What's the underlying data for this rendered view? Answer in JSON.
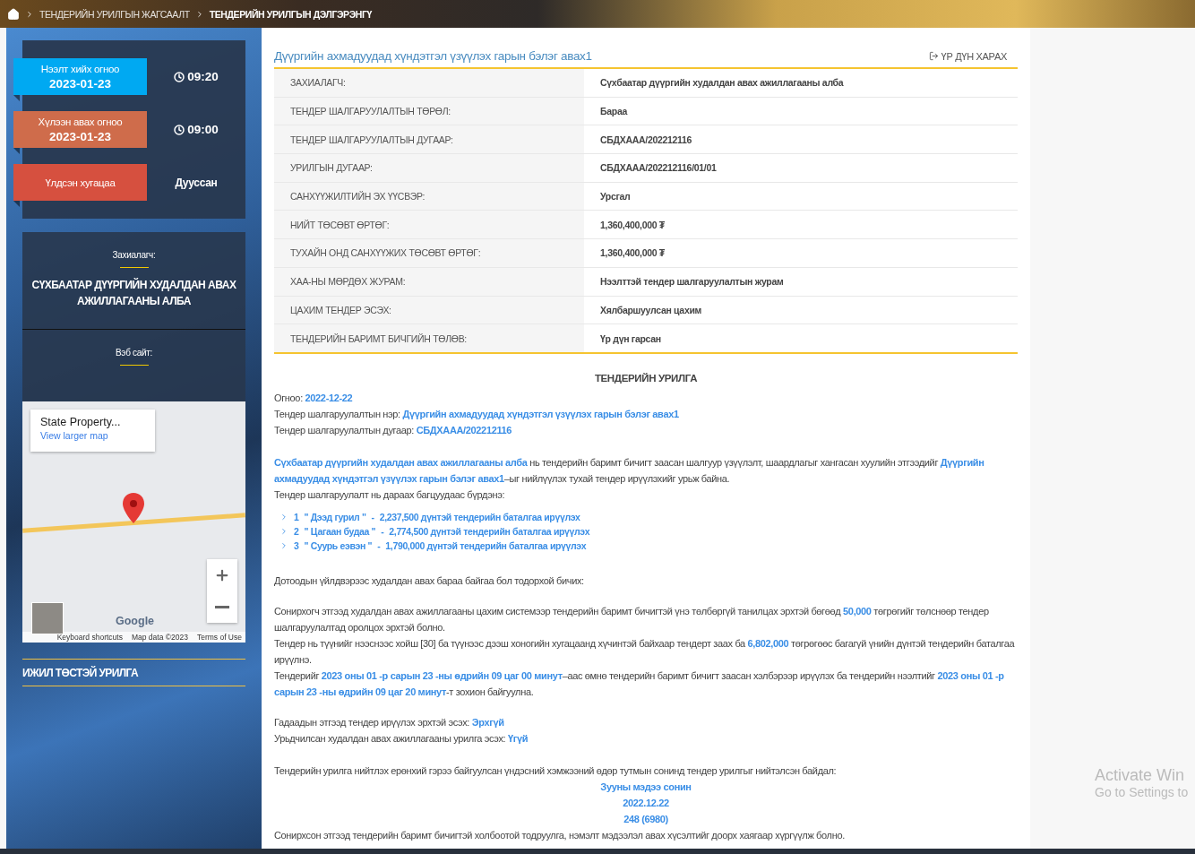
{
  "breadcrumb": {
    "items": [
      "ТЕНДЕРИЙН УРИЛГЫН ЖАГСААЛТ",
      "ТЕНДЕРИЙН УРИЛГЫН ДЭЛГЭРЭНГҮ"
    ]
  },
  "schedule": [
    {
      "kind": "time",
      "label": "Нээлт хийх огноо",
      "date": "2023-01-23",
      "value": "09:20",
      "color": "#00a9f2"
    },
    {
      "kind": "time",
      "label": "Хүлээн авах огноо",
      "date": "2023-01-23",
      "value": "09:00",
      "color": "#cf6c4b"
    },
    {
      "kind": "status",
      "label": "Үлдсэн хугацаа",
      "value": "Дууссан",
      "color": "#d6503f"
    }
  ],
  "customer": {
    "label": "Захиалагч:",
    "name": "СҮХБААТАР ДҮҮРГИЙН ХУДАЛДАН АВАХ АЖИЛЛАГААНЫ АЛБА",
    "website_label": "Вэб сайт:"
  },
  "map": {
    "place": "State Property...",
    "link": "View larger map",
    "logo": "Google",
    "footer": [
      "Keyboard shortcuts",
      "Map data ©2023",
      "Terms of Use"
    ]
  },
  "related": {
    "heading": "ИЖИЛ ТӨСТЭЙ УРИЛГА"
  },
  "tender": {
    "title": "Дүүргийн ахмадуудад хүндэтгэл үзүүлэх гарын бэлэг авах1",
    "result_link": "ҮР ДҮН ХАРАХ"
  },
  "details": [
    {
      "label": "ЗАХИАЛАГЧ:",
      "value": "Сүхбаатар дүүргийн худалдан авах ажиллагааны алба"
    },
    {
      "label": "ТЕНДЕР ШАЛГАРУУЛАЛТЫН ТӨРӨЛ:",
      "value": "Бараа"
    },
    {
      "label": "ТЕНДЕР ШАЛГАРУУЛАЛТЫН ДУГААР:",
      "value": "СБДХААА/202212116"
    },
    {
      "label": "УРИЛГЫН ДУГААР:",
      "value": "СБДХААА/202212116/01/01"
    },
    {
      "label": "САНХҮҮЖИЛТИЙН ЭХ ҮҮСВЭР:",
      "value": "Урсгал"
    },
    {
      "label": "НИЙТ ТӨСӨВТ ӨРТӨГ:",
      "value": "1,360,400,000 ₮"
    },
    {
      "label": "ТУХАЙН ОНД САНХҮҮЖИХ ТӨСӨВТ ӨРТӨГ:",
      "value": "1,360,400,000 ₮"
    },
    {
      "label": "ХАА-НЫ МӨРДӨХ ЖУРАМ:",
      "value": "Нээлттэй тендер шалгаруулалтын журам"
    },
    {
      "label": "ЦАХИМ ТЕНДЕР ЭСЭХ:",
      "value": "Хялбаршуулсан цахим"
    },
    {
      "label": "ТЕНДЕРИЙН БАРИМТ БИЧГИЙН ТӨЛӨВ:",
      "value": "Үр дүн гарсан"
    }
  ],
  "notice": {
    "heading": "ТЕНДЕРИЙН УРИЛГА",
    "meta": [
      {
        "label": "Огноо:",
        "value": "2022-12-22"
      },
      {
        "label": "Тендер шалгаруулалтын нэр:",
        "value": "Дүүргийн ахмадуудад хүндэтгэл үзүүлэх гарын бэлэг авах1"
      },
      {
        "label": "Тендер шалгаруулалтын дугаар:",
        "value": "СБДХААА/202212116"
      }
    ],
    "intro": [
      "**Сүхбаатар дүүргийн худалдан авах ажиллагааны алба** нь тендерийн баримт бичигт заасан шалгуур үзүүлэлт, шаардлагыг хангасан хуулийн этгээдийг **Дүүргийн ахмадуудад хүндэтгэл үзүүлэх гарын бэлэг авах1**–ыг нийлүүлэх тухай тендер ирүүлэхийг урьж байна.",
      "Тендер шалгаруулалт нь дараах багцуудаас бүрдэнэ:"
    ],
    "lots": [
      {
        "number": "1",
        "name": "\" Дээд гурил \"",
        "separator": "-",
        "guarantee": "2,237,500 дүнтэй тендерийн баталгаа ирүүлэх"
      },
      {
        "number": "2",
        "name": "\" Цагаан будаа \"",
        "separator": "-",
        "guarantee": "2,774,500 дүнтэй тендерийн баталгаа ирүүлэх"
      },
      {
        "number": "3",
        "name": "\" Суурь еэвэн \"",
        "separator": "-",
        "guarantee": "1,790,000 дүнтэй тендерийн баталгаа ирүүлэх"
      }
    ],
    "groups": [
      [
        "Дотоодын үйлдвэрээс худалдан авах бараа байгаа бол тодорхой бичих:"
      ],
      [
        "Сонирхогч этгээд худалдан авах ажиллагааны цахим системээр тендерийн баримт бичигтэй үнэ төлбөргүй танилцах эрхтэй бөгөөд **50,000** төгрөгийг төлснөөр тендер шалгаруулалтад оролцох эрхтэй болно.",
        "Тендер нь түүнийг нээснээс хойш [30] ба түүнээс дээш хоногийн хугацаанд хүчинтэй байхаар тендерт заах ба **6,802,000** төгрөгөөс багагүй үнийн дүнтэй тендерийн баталгаа ирүүлнэ.",
        "Тендерийг **2023 оны 01 -р сарын 23 -ны өдрийн 09 цаг 00 минут**–аас өмнө тендерийн баримт бичигт заасан хэлбэрээр ирүүлэх ба тендерийн нээлтийг **2023 оны 01 -р сарын 23 -ны өдрийн 09 цаг 20 минут**-т зохион байгуулна."
      ],
      [
        "Гадаадын этгээд тендер ирүүлэх эрхтэй эсэх:  **Эрхгүй**",
        "Урьдчилсан худалдан авах ажиллагааны урилга эсэх:  **Үгүй**"
      ]
    ],
    "publication": {
      "intro": "Тендерийн урилга нийтлэх ерөнхий гэрээ байгуулсан үндэсний хэмжээний өдөр тутмын сонинд тендер урилгыг нийтэлсэн байдал:",
      "lines": [
        "Зууны мэдээ сонин",
        "2022.12.22",
        "248 (6980)"
      ]
    },
    "closing": "Сонирхсон этгээд тендерийн баримт бичигтэй холбоотой тодруулга, нэмэлт мэдээлэл авах хүсэлтийг доорх хаягаар хүргүүлж болно."
  },
  "os_notice": {
    "title": "Activate Win",
    "subtitle": "Go to Settings to"
  }
}
